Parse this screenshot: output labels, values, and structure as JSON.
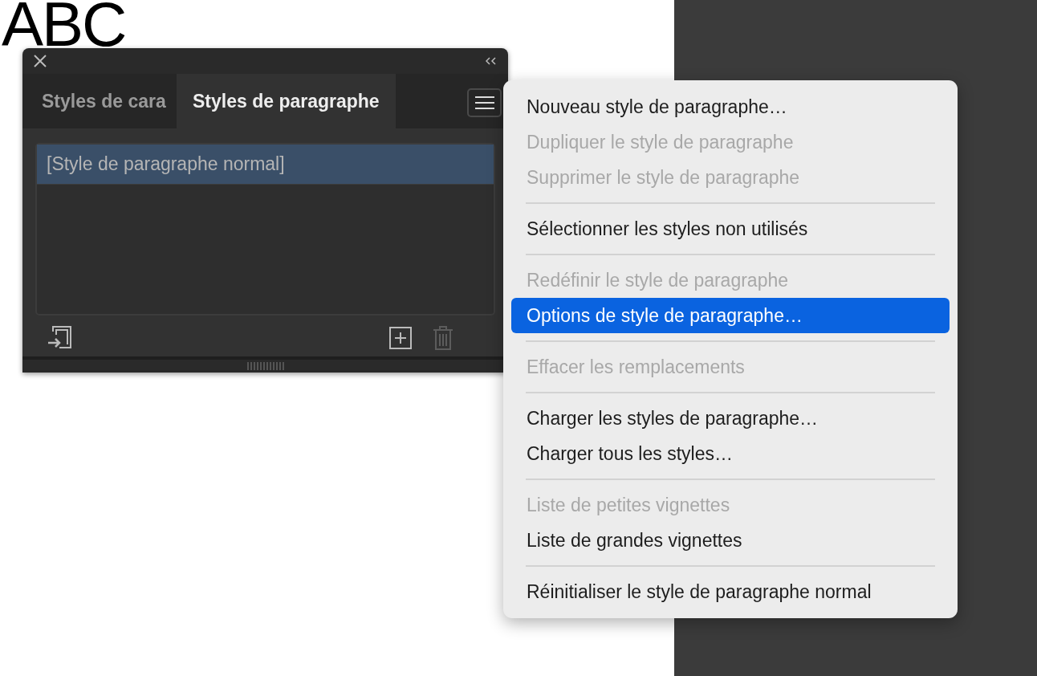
{
  "canvas": {
    "text": "ABC"
  },
  "panel": {
    "tabs": [
      {
        "label": "Styles de cara",
        "selected": false
      },
      {
        "label": "Styles de paragraphe",
        "selected": true
      }
    ],
    "styles": [
      {
        "label": "[Style de paragraphe normal]",
        "selected": true
      }
    ]
  },
  "menu": {
    "items": [
      {
        "kind": "item",
        "label": "Nouveau style de paragraphe…",
        "disabled": false,
        "selected": false
      },
      {
        "kind": "item",
        "label": "Dupliquer le style de paragraphe",
        "disabled": true,
        "selected": false
      },
      {
        "kind": "item",
        "label": "Supprimer le style de paragraphe",
        "disabled": true,
        "selected": false
      },
      {
        "kind": "separator"
      },
      {
        "kind": "item",
        "label": "Sélectionner les styles non utilisés",
        "disabled": false,
        "selected": false
      },
      {
        "kind": "separator"
      },
      {
        "kind": "item",
        "label": "Redéfinir le style de paragraphe",
        "disabled": true,
        "selected": false
      },
      {
        "kind": "item",
        "label": "Options de style de paragraphe…",
        "disabled": false,
        "selected": true
      },
      {
        "kind": "separator"
      },
      {
        "kind": "item",
        "label": "Effacer les remplacements",
        "disabled": true,
        "selected": false
      },
      {
        "kind": "separator"
      },
      {
        "kind": "item",
        "label": "Charger les styles de paragraphe…",
        "disabled": false,
        "selected": false
      },
      {
        "kind": "item",
        "label": "Charger tous les styles…",
        "disabled": false,
        "selected": false
      },
      {
        "kind": "separator"
      },
      {
        "kind": "item",
        "label": "Liste de petites vignettes",
        "disabled": true,
        "selected": false
      },
      {
        "kind": "item",
        "label": "Liste de grandes vignettes",
        "disabled": false,
        "selected": false
      },
      {
        "kind": "separator"
      },
      {
        "kind": "item",
        "label": "Réinitialiser le style de paragraphe normal",
        "disabled": false,
        "selected": false
      }
    ]
  }
}
